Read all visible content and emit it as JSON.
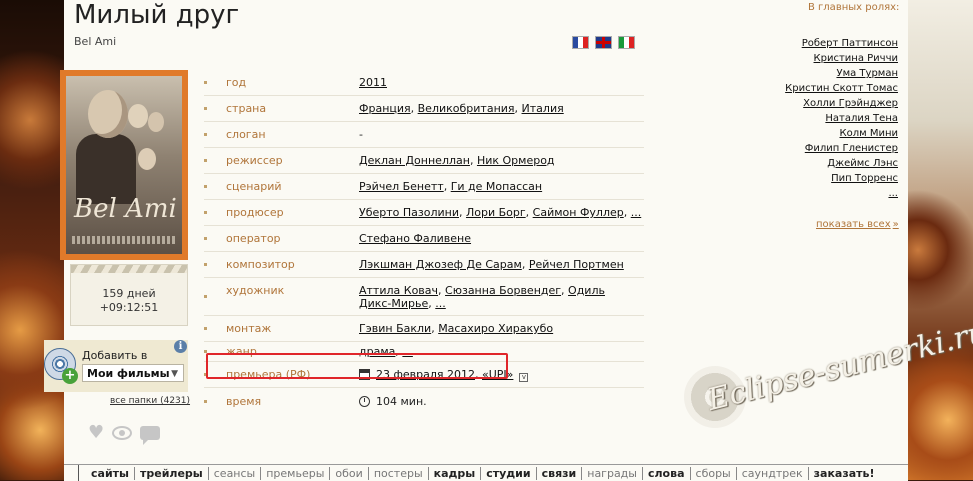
{
  "movie": {
    "title": "Милый друг",
    "original_title": "Bel Ami",
    "poster_title": "Bel Ami"
  },
  "language_flags": [
    "french-flag",
    "uk-flag",
    "italian-flag"
  ],
  "countdown": {
    "days": "159 дней",
    "time": "+09:12:51"
  },
  "add_to": {
    "label": "Добавить в",
    "selected": "Мои фильмы",
    "all_folders": "все папки (4231)"
  },
  "info": {
    "year": {
      "label": "год",
      "value": "2011"
    },
    "country": {
      "label": "страна",
      "values": [
        "Франция",
        "Великобритания",
        "Италия"
      ]
    },
    "tagline": {
      "label": "слоган",
      "value": "-"
    },
    "director": {
      "label": "режиссер",
      "values": [
        "Деклан Доннеллан",
        "Ник Ормерод"
      ]
    },
    "writer": {
      "label": "сценарий",
      "values": [
        "Рэйчел Бенетт",
        "Ги де Мопассан"
      ]
    },
    "producer": {
      "label": "продюсер",
      "values": [
        "Уберто Пазолини",
        "Лори Борг",
        "Саймон Фуллер",
        "..."
      ]
    },
    "operator": {
      "label": "оператор",
      "values": [
        "Стефано Фаливене"
      ]
    },
    "composer": {
      "label": "композитор",
      "values": [
        "Лэкшман Джозеф Де Сарам",
        "Рейчел Портмен"
      ]
    },
    "artist": {
      "label": "художник",
      "values": [
        "Аттила Ковач",
        "Сюзанна Борвендег",
        "Одиль Дикс-Мирье",
        "..."
      ]
    },
    "editing": {
      "label": "монтаж",
      "values": [
        "Гэвин Бакли",
        "Масахиро Хиракубо"
      ]
    },
    "genre": {
      "label": "жанр",
      "values": [
        "драма",
        "..."
      ]
    },
    "premiere": {
      "label": "премьера (РФ)",
      "date": "23 февраля 2012",
      "distributor": "«UPI»"
    },
    "runtime": {
      "label": "время",
      "value": "104 мин."
    }
  },
  "cast": {
    "title": "В главных ролях:",
    "actors": [
      "Роберт Паттинсон",
      "Кристина Риччи",
      "Ума Турман",
      "Кристин Скотт Томас",
      "Холли Грэйнджер",
      "Наталия Тена",
      "Колм Мини",
      "Филип Гленистер",
      "Джеймс Лэнс",
      "Пип Торренс",
      "..."
    ],
    "show_all": "показать всех",
    "show_all_arrow": "»"
  },
  "watermark": "Eclipse-sumerki.ru",
  "bottom_nav": [
    {
      "label": "сайты",
      "dim": false
    },
    {
      "label": "трейлеры",
      "dim": false
    },
    {
      "label": "сеансы",
      "dim": true
    },
    {
      "label": "премьеры",
      "dim": true
    },
    {
      "label": "обои",
      "dim": true
    },
    {
      "label": "постеры",
      "dim": true
    },
    {
      "label": "кадры",
      "dim": false
    },
    {
      "label": "студии",
      "dim": false
    },
    {
      "label": "связи",
      "dim": false
    },
    {
      "label": "награды",
      "dim": true
    },
    {
      "label": "слова",
      "dim": false
    },
    {
      "label": "сборы",
      "dim": true
    },
    {
      "label": "саундтрек",
      "dim": true
    },
    {
      "label": "заказать!",
      "dim": false
    }
  ],
  "colors": {
    "label": "#b0753a",
    "highlight": "#e0262a",
    "page_bg": "#fbfaf4"
  }
}
